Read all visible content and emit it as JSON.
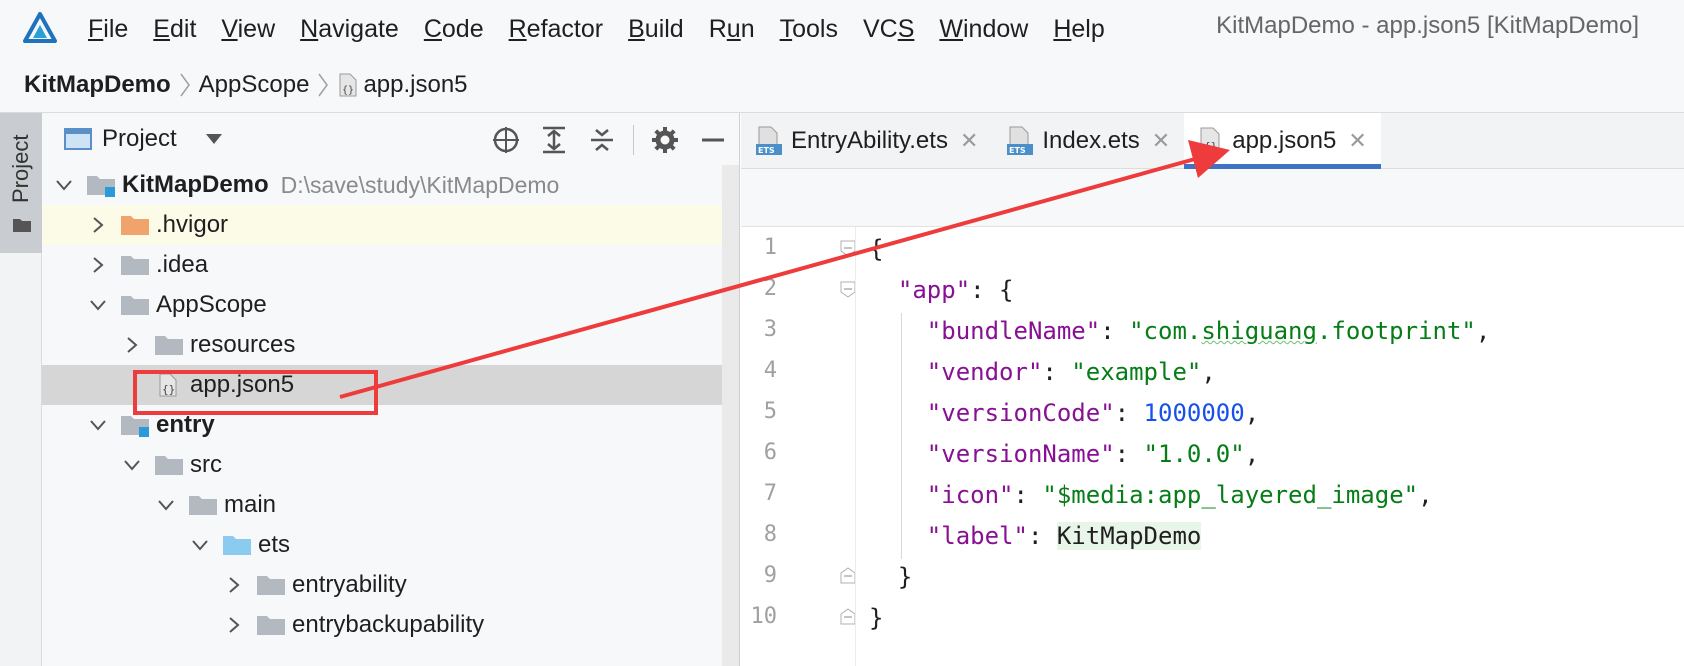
{
  "menubar": {
    "items": [
      {
        "label": "File",
        "mnemonic_index": 0
      },
      {
        "label": "Edit",
        "mnemonic_index": 0
      },
      {
        "label": "View",
        "mnemonic_index": 0
      },
      {
        "label": "Navigate",
        "mnemonic_index": 0
      },
      {
        "label": "Code",
        "mnemonic_index": 0
      },
      {
        "label": "Refactor",
        "mnemonic_index": 0
      },
      {
        "label": "Build",
        "mnemonic_index": 0
      },
      {
        "label": "Run",
        "mnemonic_index": 1
      },
      {
        "label": "Tools",
        "mnemonic_index": 0
      },
      {
        "label": "VCS",
        "mnemonic_index": 2
      },
      {
        "label": "Window",
        "mnemonic_index": 0
      },
      {
        "label": "Help",
        "mnemonic_index": 0
      }
    ],
    "window_title": "KitMapDemo - app.json5 [KitMapDemo]"
  },
  "breadcrumb": {
    "items": [
      "KitMapDemo",
      "AppScope",
      "app.json5"
    ]
  },
  "tool_strip": {
    "project_label": "Project"
  },
  "project_panel": {
    "title": "Project",
    "tree": [
      {
        "label": "KitMapDemo",
        "path": "D:\\save\\study\\KitMapDemo",
        "depth": 0,
        "expanded": true,
        "kind": "module",
        "bold": true
      },
      {
        "label": ".hvigor",
        "depth": 1,
        "expanded": false,
        "kind": "folder-orange",
        "highlight": true
      },
      {
        "label": ".idea",
        "depth": 1,
        "expanded": false,
        "kind": "folder"
      },
      {
        "label": "AppScope",
        "depth": 1,
        "expanded": true,
        "kind": "folder"
      },
      {
        "label": "resources",
        "depth": 2,
        "expanded": false,
        "kind": "folder"
      },
      {
        "label": "app.json5",
        "depth": 2,
        "kind": "json-file",
        "selected": true
      },
      {
        "label": "entry",
        "depth": 1,
        "expanded": true,
        "kind": "module",
        "bold": true
      },
      {
        "label": "src",
        "depth": 2,
        "expanded": true,
        "kind": "folder"
      },
      {
        "label": "main",
        "depth": 3,
        "expanded": true,
        "kind": "folder"
      },
      {
        "label": "ets",
        "depth": 4,
        "expanded": true,
        "kind": "folder-blue"
      },
      {
        "label": "entryability",
        "depth": 5,
        "expanded": false,
        "kind": "folder"
      },
      {
        "label": "entrybackupability",
        "depth": 5,
        "expanded": false,
        "kind": "folder"
      }
    ]
  },
  "editor": {
    "tabs": [
      {
        "label": "EntryAbility.ets",
        "icon": "ets-file-icon",
        "active": false
      },
      {
        "label": "Index.ets",
        "icon": "ets-file-icon",
        "active": false
      },
      {
        "label": "app.json5",
        "icon": "json-file-icon",
        "active": true
      }
    ],
    "close_glyph": "✕",
    "line_numbers": [
      "1",
      "2",
      "3",
      "4",
      "5",
      "6",
      "7",
      "8",
      "9",
      "10"
    ],
    "lines": [
      [
        {
          "t": "{",
          "c": "punc"
        }
      ],
      [
        {
          "t": "  ",
          "c": "plain"
        },
        {
          "t": "\"app\"",
          "c": "key"
        },
        {
          "t": ": {",
          "c": "punc"
        }
      ],
      [
        {
          "t": "    ",
          "c": "plain"
        },
        {
          "t": "\"bundleName\"",
          "c": "key"
        },
        {
          "t": ": ",
          "c": "punc"
        },
        {
          "t": "\"com.",
          "c": "str"
        },
        {
          "t": "shiguang",
          "c": "str squiggle"
        },
        {
          "t": ".footprint\"",
          "c": "str"
        },
        {
          "t": ",",
          "c": "punc"
        }
      ],
      [
        {
          "t": "    ",
          "c": "plain"
        },
        {
          "t": "\"vendor\"",
          "c": "key"
        },
        {
          "t": ": ",
          "c": "punc"
        },
        {
          "t": "\"example\"",
          "c": "str"
        },
        {
          "t": ",",
          "c": "punc"
        }
      ],
      [
        {
          "t": "    ",
          "c": "plain"
        },
        {
          "t": "\"versionCode\"",
          "c": "key"
        },
        {
          "t": ": ",
          "c": "punc"
        },
        {
          "t": "1000000",
          "c": "num"
        },
        {
          "t": ",",
          "c": "punc"
        }
      ],
      [
        {
          "t": "    ",
          "c": "plain"
        },
        {
          "t": "\"versionName\"",
          "c": "key"
        },
        {
          "t": ": ",
          "c": "punc"
        },
        {
          "t": "\"1.0.0\"",
          "c": "str"
        },
        {
          "t": ",",
          "c": "punc"
        }
      ],
      [
        {
          "t": "    ",
          "c": "plain"
        },
        {
          "t": "\"icon\"",
          "c": "key"
        },
        {
          "t": ": ",
          "c": "punc"
        },
        {
          "t": "\"$media:app_layered_image\"",
          "c": "str"
        },
        {
          "t": ",",
          "c": "punc"
        }
      ],
      [
        {
          "t": "    ",
          "c": "plain"
        },
        {
          "t": "\"label\"",
          "c": "key"
        },
        {
          "t": ": ",
          "c": "punc"
        },
        {
          "t": "KitMapDemo",
          "c": "ident"
        }
      ],
      [
        {
          "t": "  ",
          "c": "plain"
        },
        {
          "t": "}",
          "c": "punc"
        }
      ],
      [
        {
          "t": "}",
          "c": "punc"
        }
      ]
    ]
  },
  "colors": {
    "accent": "#3f72c4",
    "annotation": "#ee3b3b",
    "key": "#871094",
    "string": "#067d17",
    "number": "#1750eb"
  }
}
